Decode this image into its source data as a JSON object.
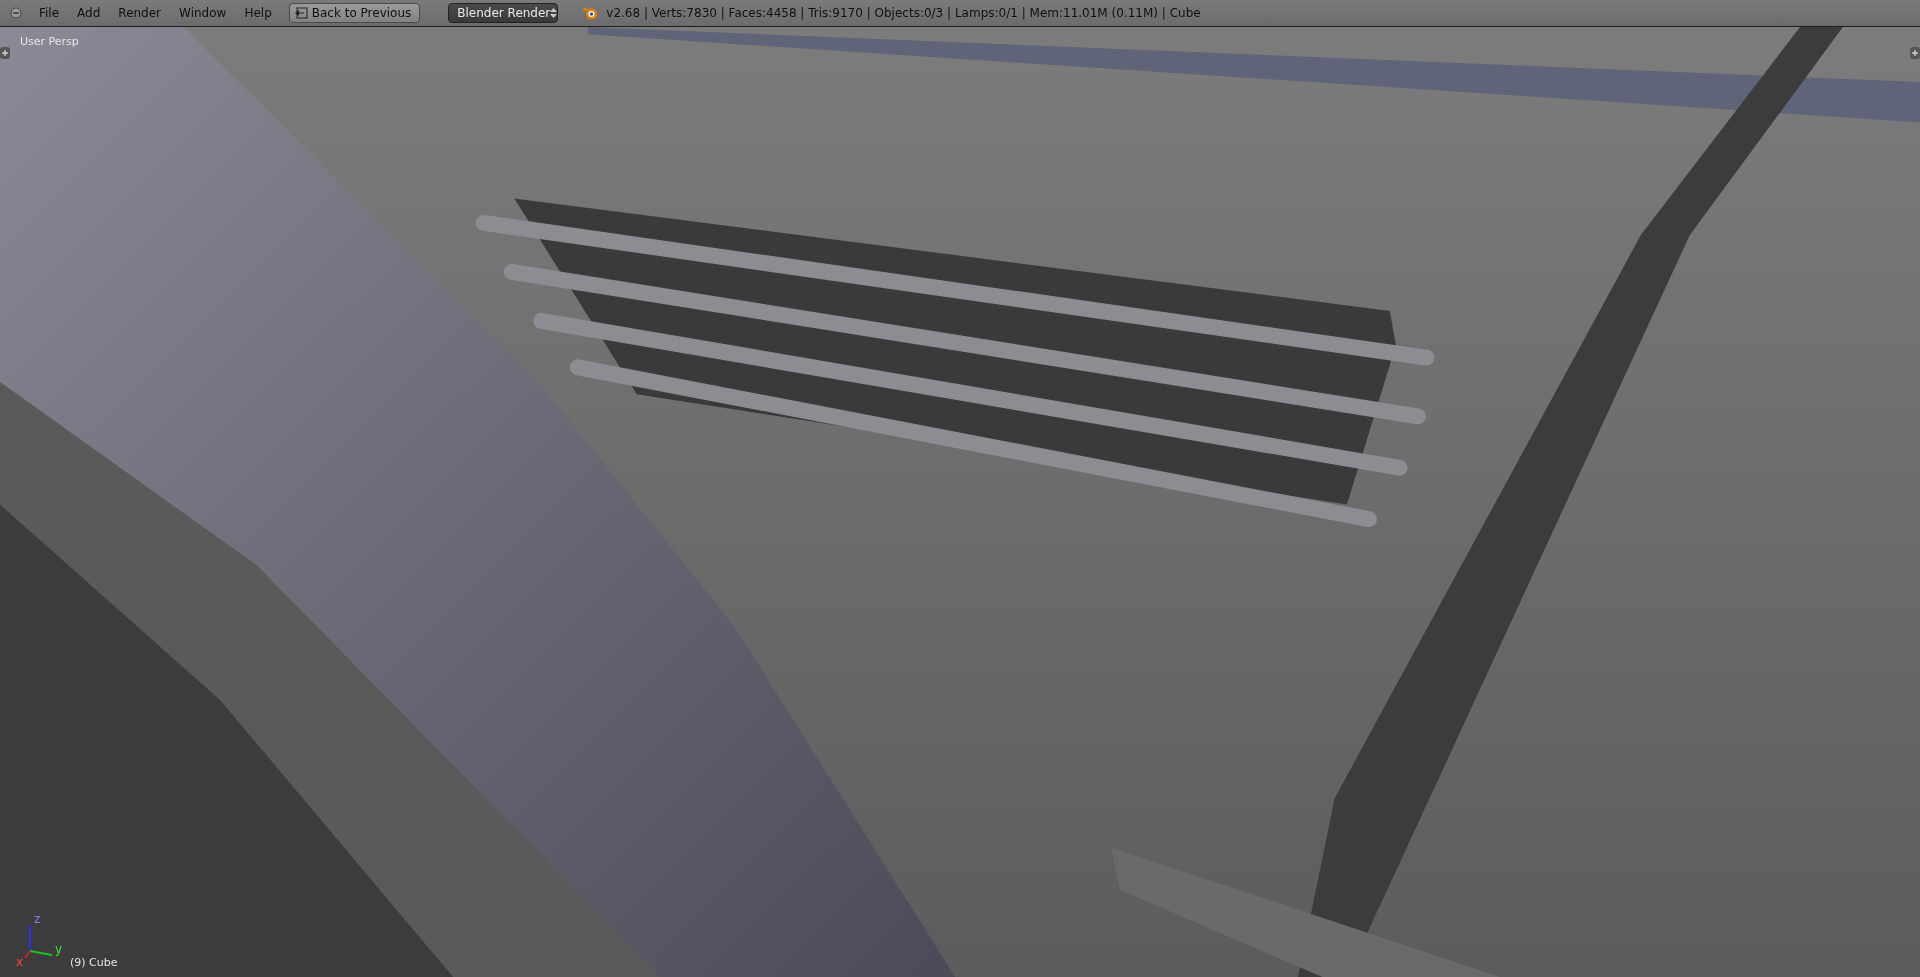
{
  "header": {
    "menu": [
      "File",
      "Add",
      "Render",
      "Window",
      "Help"
    ],
    "back_button": "Back to Previous",
    "render_engine": "Blender Render",
    "stats": "v2.68 | Verts:7830 | Faces:4458 | Tris:9170 | Objects:0/3 | Lamps:0/1 | Mem:11.01M (0.11M) | Cube"
  },
  "viewport": {
    "view_label": "User Persp",
    "object_label": "(9) Cube",
    "axes": [
      "x",
      "y",
      "z"
    ]
  }
}
